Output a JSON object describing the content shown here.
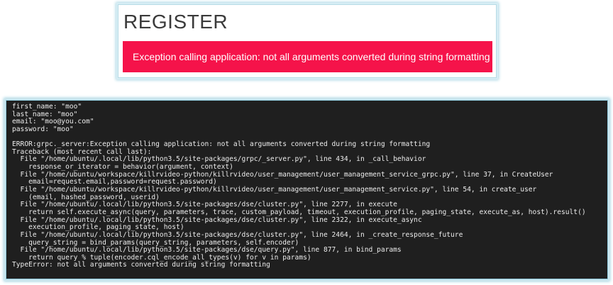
{
  "register": {
    "title": "REGISTER",
    "error_message": "Exception calling application: not all arguments converted during string formatting",
    "error_color": "#f5134a"
  },
  "terminal": {
    "lines": [
      "first_name: \"moo\"",
      "last_name: \"moo\"",
      "email: \"moo@you.com\"",
      "password: \"moo\"",
      "",
      "ERROR:grpc._server:Exception calling application: not all arguments converted during string formatting",
      "Traceback (most recent call last):",
      "  File \"/home/ubuntu/.local/lib/python3.5/site-packages/grpc/_server.py\", line 434, in _call_behavior",
      "    response_or_iterator = behavior(argument, context)",
      "  File \"/home/ubuntu/workspace/killrvideo-python/killrvideo/user_management/user_management_service_grpc.py\", line 37, in CreateUser",
      "    email=request.email,password=request.password)",
      "  File \"/home/ubuntu/workspace/killrvideo-python/killrvideo/user_management/user_management_service.py\", line 54, in create_user",
      "    (email, hashed_password, userid)",
      "  File \"/home/ubuntu/.local/lib/python3.5/site-packages/dse/cluster.py\", line 2277, in execute",
      "    return self.execute_async(query, parameters, trace, custom_payload, timeout, execution_profile, paging_state, execute_as, host).result()",
      "  File \"/home/ubuntu/.local/lib/python3.5/site-packages/dse/cluster.py\", line 2322, in execute_async",
      "    execution_profile, paging_state, host)",
      "  File \"/home/ubuntu/.local/lib/python3.5/site-packages/dse/cluster.py\", line 2464, in _create_response_future",
      "    query_string = bind_params(query_string, parameters, self.encoder)",
      "  File \"/home/ubuntu/.local/lib/python3.5/site-packages/dse/query.py\", line 877, in bind_params",
      "    return query % tuple(encoder.cql_encode_all_types(v) for v in params)",
      "TypeError: not all arguments converted during string formatting"
    ]
  }
}
